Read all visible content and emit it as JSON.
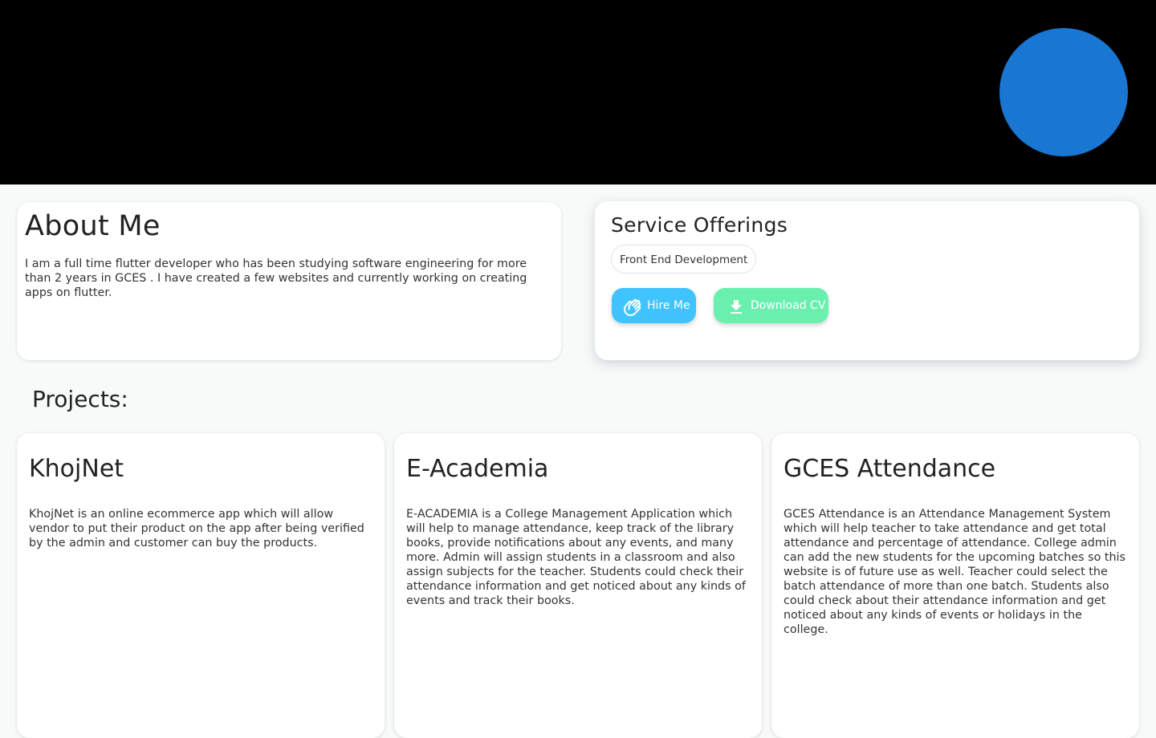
{
  "about": {
    "title": "About Me",
    "text": "I am a full time flutter developer who has been studying software engineering for more than 2 years in GCES . I have created a few websites and currently working on creating apps on flutter."
  },
  "services": {
    "title": "Service Offerings",
    "chip_label": "Front End Development",
    "hire_label": "Hire Me",
    "download_label": "Download CV",
    "hire_icon": "waving-hand-icon",
    "download_icon": "download-icon"
  },
  "projects": {
    "heading": "Projects:",
    "items": [
      {
        "title": "KhojNet",
        "description": "KhojNet is an online ecommerce app which will allow vendor to put their product on the app after being verified by the admin and customer can buy the products."
      },
      {
        "title": "E-Academia",
        "description": "E-ACADEMIA is a College Management Application which will help to manage attendance, keep track of the library books, provide notifications about any events, and many more. Admin will assign students in a classroom and also assign subjects for the teacher. Students could check their attendance information and get noticed about any kinds of events and track their books."
      },
      {
        "title": "GCES Attendance",
        "description": "GCES Attendance is an Attendance Management System which will help teacher to take attendance and get total attendance and percentage of attendance. College admin can add the new students for the upcoming batches so this website is of future use as well. Teacher could select the batch attendance of more than one batch. Students also could check about their attendance information and get noticed about any kinds of events or holidays in the college."
      }
    ]
  },
  "colors": {
    "header_bg": "#000000",
    "avatar": "#1976d2",
    "hire_button": "#40c4ff",
    "download_button": "#69f0ae",
    "page_bg": "#f8f9f9"
  }
}
